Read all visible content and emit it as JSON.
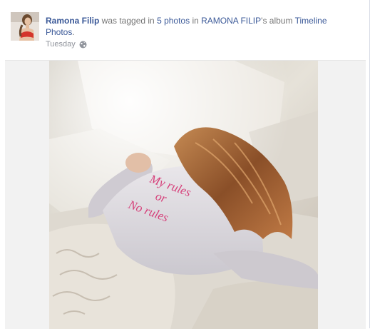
{
  "story": {
    "actor": "Ramona Filip",
    "text_tagged": " was tagged in ",
    "photos_link": "5 photos",
    "text_in": " in ",
    "album_owner": "RAMONA FILIP",
    "text_album": "'s album ",
    "album_name": "Timeline Photos",
    "period": ".",
    "timestamp": "Tuesday",
    "privacy_icon": "globe-icon",
    "photo_text": [
      "My rules",
      "or",
      "No rules"
    ]
  },
  "colors": {
    "link": "#3b5998",
    "text_gray": "#757575",
    "photo_text_pink": "#d6407a"
  }
}
